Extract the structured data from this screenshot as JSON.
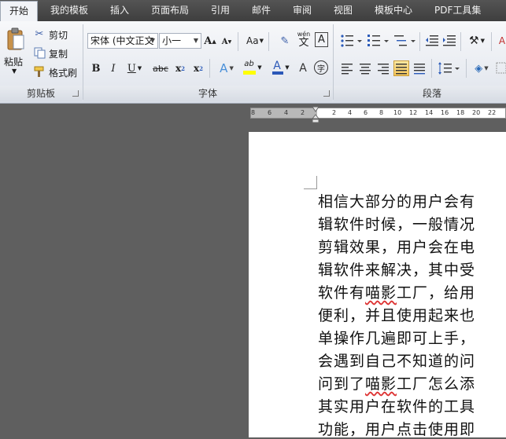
{
  "tabs": [
    "开始",
    "我的模板",
    "插入",
    "页面布局",
    "引用",
    "邮件",
    "审阅",
    "视图",
    "模板中心",
    "PDF工具集"
  ],
  "clipboard": {
    "paste": "粘贴",
    "cut": "剪切",
    "copy": "复制",
    "format_painter": "格式刷",
    "group_label": "剪贴板"
  },
  "font": {
    "name": "宋体 (中文正文",
    "size": "小一",
    "group_label": "字体",
    "change_case": "Aa",
    "wen": "wén",
    "wen_char": "文",
    "char_border": "A",
    "enclose": "字"
  },
  "paragraph": {
    "group_label": "段落"
  },
  "ruler": {
    "numbers": [
      "8",
      "6",
      "4",
      "2",
      "2",
      "4",
      "6",
      "8",
      "10",
      "12",
      "14",
      "16",
      "18",
      "20",
      "22"
    ]
  },
  "document": {
    "lines": [
      "相信大部分的用户会有",
      "辑软件时候，一般情况",
      "剪辑效果，用户会在电",
      "辑软件来解决，其中受",
      "软件有喵影工厂，给用",
      "便利，并且使用起来也",
      "单操作几遍即可上手，",
      "会遇到自己不知道的问",
      "问到了喵影工厂怎么添",
      "其实用户在软件的工具",
      "功能，用户点击使用即"
    ]
  },
  "colors": {
    "tab_bar": "#3e3e3e",
    "ribbon": "#e3e7ee",
    "workspace": "#5f5f5f",
    "highlight": "#f7c85a"
  }
}
